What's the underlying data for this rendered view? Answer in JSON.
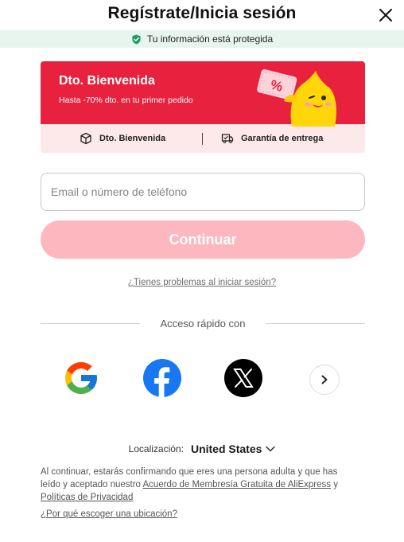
{
  "header": {
    "title": "Regístrate/Inicia sesión",
    "close_icon": "close-icon"
  },
  "protected_bar": {
    "text": "Tu información está protegida",
    "icon": "shield-check-icon",
    "icon_color": "#1ba262"
  },
  "banner": {
    "title": "Dto. Bienvenida",
    "subtitle": "Hasta -70% dto. en tu primer pedido",
    "coupon_symbol": "%",
    "bg_color": "#e8213e",
    "perks": [
      {
        "label": "Dto. Bienvenida",
        "icon": "box-icon"
      },
      {
        "label": "Garantía de entrega",
        "icon": "truck-icon"
      }
    ]
  },
  "form": {
    "email_placeholder": "Email o número de teléfono",
    "email_value": "",
    "continue_label": "Continuar",
    "trouble_link": "¿Tienes problemas al iniciar sesión?"
  },
  "quick_access": {
    "label": "Acceso rápido con",
    "providers": [
      {
        "name": "Google",
        "icon": "google-icon"
      },
      {
        "name": "Facebook",
        "icon": "facebook-icon"
      },
      {
        "name": "X",
        "icon": "x-icon"
      }
    ],
    "more_icon": "chevron-right-icon"
  },
  "location": {
    "label": "Localización:",
    "value": "United States"
  },
  "legal": {
    "text_before": "Al continuar, estarás confirmando que eres una persona adulta y que has leído y aceptado nuestro ",
    "link_membership": "Acuerdo de Membresía Gratuita de AliExpress",
    "text_and": " y ",
    "link_privacy": "Políticas de Privacidad",
    "why_link": "¿Por qué escoger una ubicación?"
  }
}
